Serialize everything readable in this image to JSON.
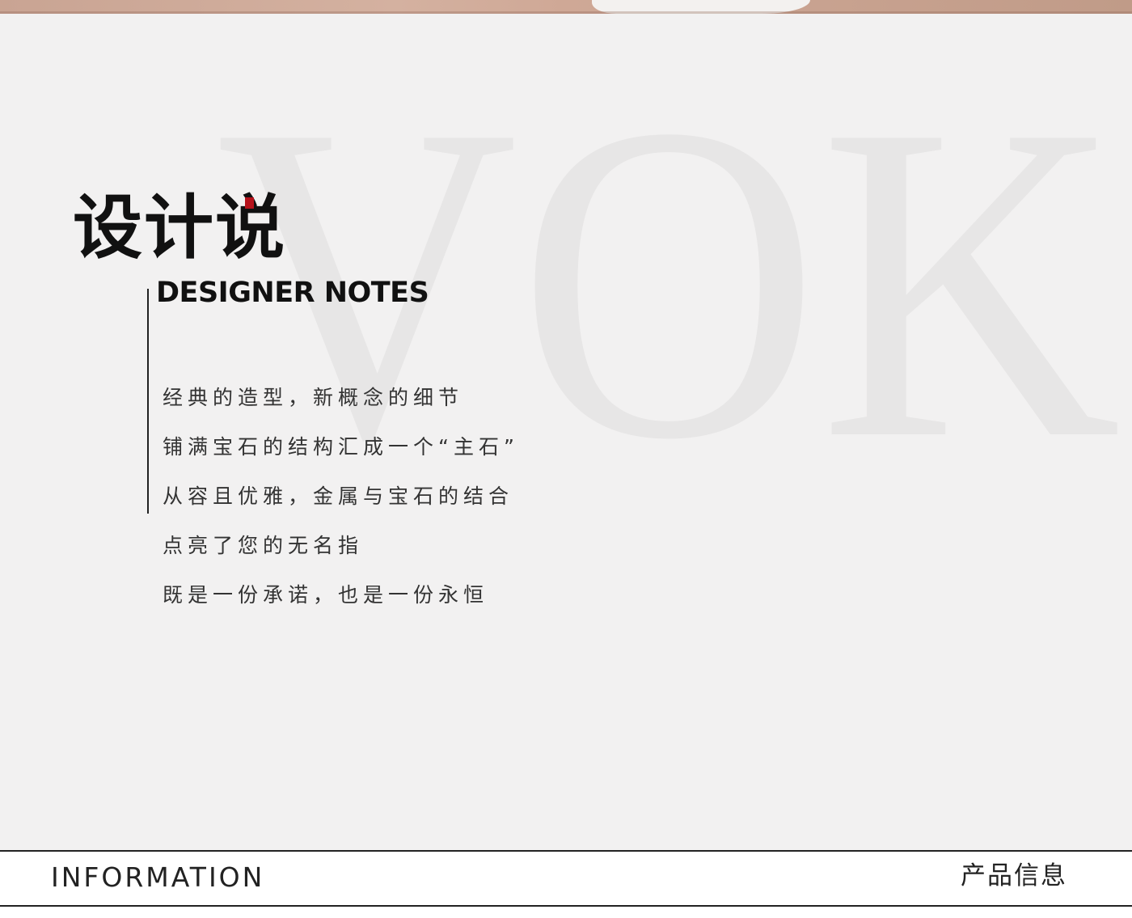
{
  "header": {
    "title_cn": "设计说",
    "title_en": "DESIGNER NOTES"
  },
  "watermark": {
    "text": "VOK"
  },
  "notes": {
    "lines": [
      "经典的造型，新概念的细节",
      "铺满宝石的结构汇成一个“主石”",
      "从容且优雅，金属与宝石的结合",
      "点亮了您的无名指",
      "既是一份承诺，也是一份永恒"
    ]
  },
  "footer": {
    "left_label": "INFORMATION",
    "right_label": "产品信息"
  },
  "colors": {
    "panel_background": "#f2f1f1",
    "accent": "#b5121b",
    "text": "#111111",
    "watermark": "#e7e6e6"
  }
}
